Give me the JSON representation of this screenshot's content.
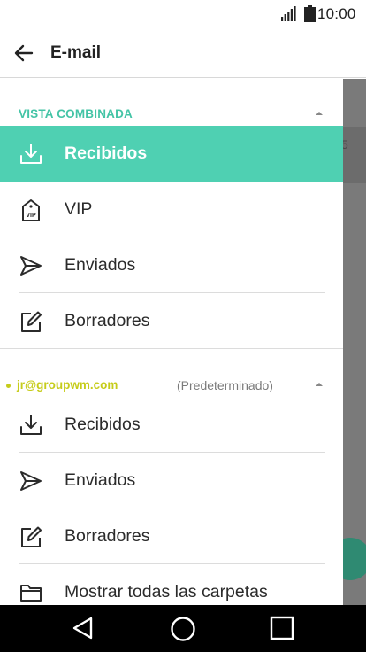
{
  "status_bar": {
    "time": "10:00",
    "signal_icon": "signal-icon",
    "battery_icon": "battery-icon"
  },
  "app_bar": {
    "title": "E-mail",
    "back_icon": "arrow-back-icon"
  },
  "drawer": {
    "combined": {
      "header": "VISTA COMBINADA",
      "items": [
        {
          "label": "Recibidos",
          "icon": "inbox-download-icon",
          "active": true
        },
        {
          "label": "VIP",
          "icon": "vip-tag-icon",
          "active": false
        },
        {
          "label": "Enviados",
          "icon": "send-icon",
          "active": false
        },
        {
          "label": "Borradores",
          "icon": "edit-icon",
          "active": false
        }
      ]
    },
    "account": {
      "email": "jr@groupwm.com",
      "default_label": "(Predeterminado)",
      "items": [
        {
          "label": "Recibidos",
          "icon": "inbox-download-icon"
        },
        {
          "label": "Enviados",
          "icon": "send-icon"
        },
        {
          "label": "Borradores",
          "icon": "edit-icon"
        },
        {
          "label": "Mostrar todas las carpetas",
          "icon": "folder-icon"
        }
      ]
    }
  },
  "background": {
    "partial_char": "5"
  },
  "colors": {
    "accent": "#4fd0b2",
    "section_header": "#44c4a6",
    "account": "#c6cc1a"
  },
  "nav_bar": {
    "back_icon": "nav-back-icon",
    "home_icon": "nav-home-icon",
    "recent_icon": "nav-recent-icon"
  }
}
